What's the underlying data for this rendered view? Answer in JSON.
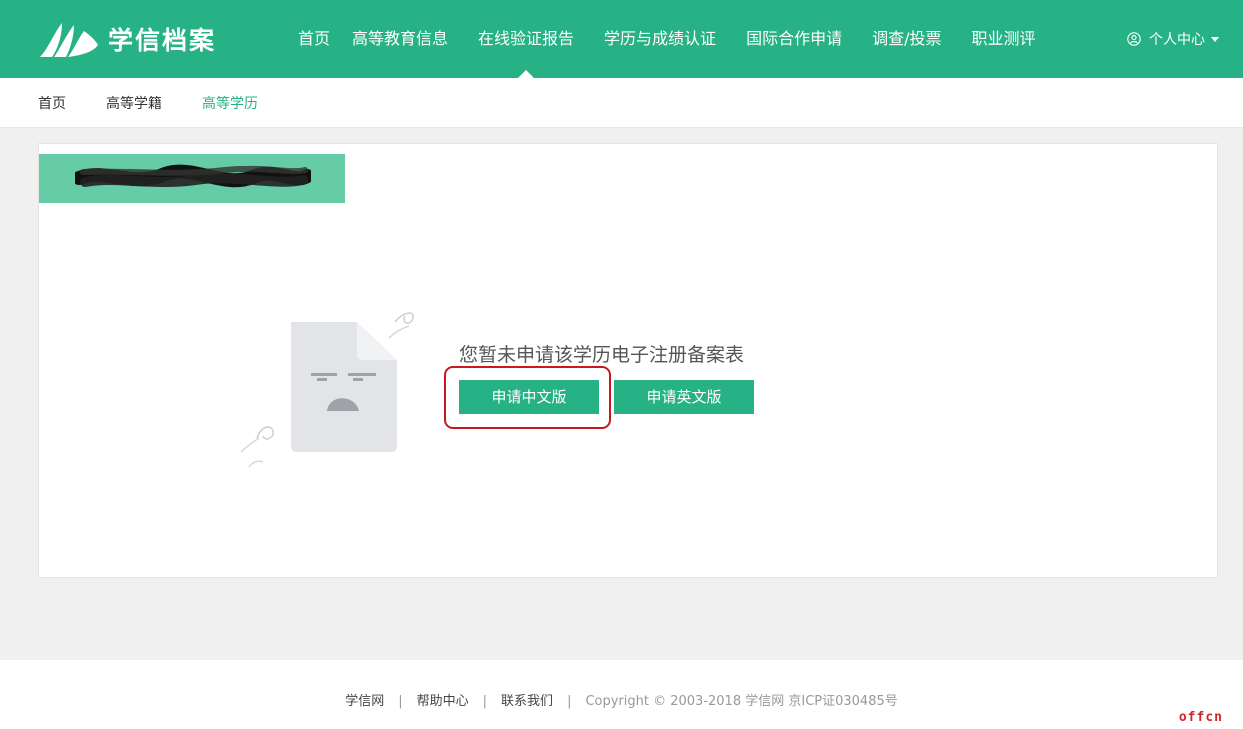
{
  "header": {
    "logo_text": "学信档案",
    "nav": [
      "首页",
      "高等教育信息",
      "在线验证报告",
      "学历与成绩认证",
      "国际合作申请",
      "调查/投票",
      "职业测评"
    ],
    "active_nav_index": 2,
    "user_center": "个人中心"
  },
  "subnav": {
    "items": [
      "首页",
      "高等学籍",
      "高等学历"
    ],
    "active_index": 2
  },
  "main": {
    "empty_message": "您暂未申请该学历电子注册备案表",
    "apply_cn_button": "申请中文版",
    "apply_en_button": "申请英文版"
  },
  "footer": {
    "links": [
      "学信网",
      "帮助中心",
      "联系我们"
    ],
    "copyright": "Copyright © 2003-2018 学信网 京ICP证030485号"
  },
  "watermark": "offcn",
  "colors": {
    "primary": "#26b285",
    "banner": "#65cca6",
    "highlight": "#c9191e"
  }
}
